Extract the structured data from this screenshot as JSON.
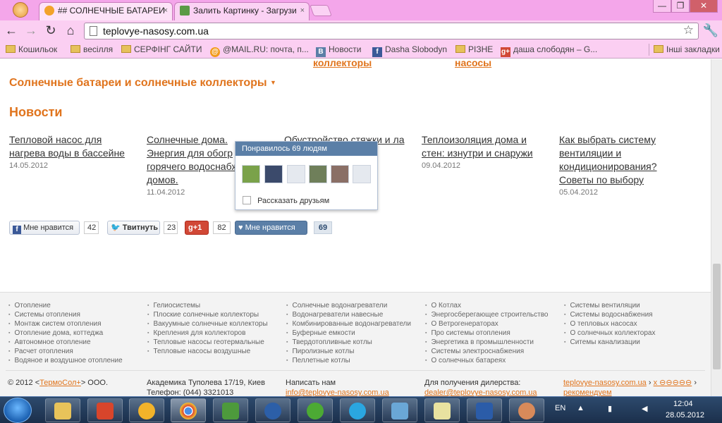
{
  "browser": {
    "tabs": [
      {
        "title": "## СОЛНЕЧНЫЕ БАТАРЕИ",
        "close": "×"
      },
      {
        "title": "Залить Картинку - Загрузи",
        "close": "×"
      }
    ],
    "window_buttons": [
      "—",
      "❐",
      "✕"
    ],
    "url": "teplovye-nasosy.com.ua",
    "bookmarks": [
      "Кошильок",
      "весілля",
      "СЕРФІНГ САЙТИ",
      "@MAIL.RU: почта, п...",
      "Новости",
      "Dasha Slobodyn",
      "РІЗНЕ",
      "даша слободян – G...",
      "Інші закладки"
    ]
  },
  "page": {
    "top_links": [
      "коллекторы",
      "насосы"
    ],
    "section_title": "Солнечные батареи и солнечные коллекторы",
    "news_heading": "Новости",
    "news": [
      {
        "title": "Тепловой насос для нагрева воды в бассейне",
        "date": "14.05.2012"
      },
      {
        "title": "Солнечные дома. Энергия для обогр горячего водоснабж домов.",
        "date": "11.04.2012"
      },
      {
        "title": "Обустройство стяжки и ла в ол»",
        "date": ""
      },
      {
        "title": "Теплоизоляция дома и стен: изнутри и снаружи",
        "date": "09.04.2012"
      },
      {
        "title": "Как выбрать систему вентиляции и кондиционирования? Советы по выбору",
        "date": "05.04.2012"
      }
    ],
    "social": {
      "fb_label": "Мне нравится",
      "fb_count": "42",
      "tw_label": "Твитнуть",
      "tw_count": "23",
      "gplus_label": "+1",
      "gplus_count": "82",
      "vk_label": "Мне нравится",
      "vk_count": "69"
    },
    "popup": {
      "header": "Понравилось 69 людям",
      "share": "Рассказать друзьям"
    }
  },
  "footer": {
    "col1": [
      "Отопление",
      "Системы отопления",
      "Монтаж систем отопления",
      "Отопление дома, коттеджа",
      "Автономное отопление",
      "Расчет отопления",
      "Водяное и воздушное отопление"
    ],
    "col2": [
      "Гелиосистемы",
      "Плоские солнечные коллекторы",
      "Вакуумные солнечные коллекторы",
      "Крепления для коллекторов",
      "Тепловые насосы геотермальные",
      "Тепловые насосы воздушные"
    ],
    "col3": [
      "Солнечные водонагреватели",
      "Водонагреватели навесные",
      "Комбинированные водонагреватели",
      "Буферные емкости",
      "Твердотопливные котлы",
      "Пиролизные котлы",
      "Пеллетные котлы"
    ],
    "col4": [
      "О Котлах",
      "Энергосберегающее строительство",
      "О Ветрогенераторах",
      "Про системы отопления",
      "Энергетика в промышленности",
      "Системы электроснабжения",
      "О солнечных батареях"
    ],
    "col5": [
      "Системы вентиляции",
      "Системы водоснабжения",
      "О тепловых насосах",
      "О солнечных коллекторах",
      "Ситемы канализации"
    ],
    "copyright_pre": "© 2012 <",
    "copyright_link": "ТермоСол+",
    "copyright_post": "> ООО.",
    "address": "Академика Туполева 17/19, Киев",
    "phone": "Телефон: (044) 3321013",
    "write_label": "Написать нам",
    "write_email": "info@teplovye-nasosy.com.ua",
    "dealer_label": "Для получения дилерства:",
    "dealer_email": "dealer@teplovye-nasosy.com.ua",
    "site_link": "teplovye-nasosy.com.ua",
    "site_sep": "›",
    "site_x": "x ⊖⊖⊖⊖⊖",
    "site_rec": "рекомендуем"
  },
  "taskbar": {
    "lang": "EN",
    "time": "12:04",
    "date": "28.05.2012"
  },
  "colors": {
    "accent": "#e0741d",
    "vk": "#5b7fa7",
    "tabbar": "#f4a6ea"
  }
}
